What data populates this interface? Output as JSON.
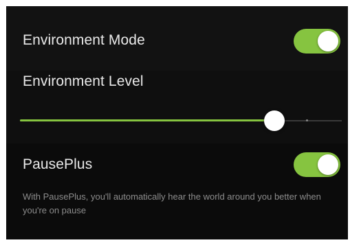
{
  "colors": {
    "accent": "#86c440",
    "panel_background": "#0b0b0b",
    "label_text": "#e9e9e9",
    "description_text": "#8c8c8c"
  },
  "environment_mode": {
    "label": "Environment Mode",
    "enabled": true
  },
  "environment_level": {
    "label": "Environment Level",
    "value_fraction": 0.79
  },
  "pauseplus": {
    "label": "PausePlus",
    "enabled": true,
    "description": "With PausePlus, you'll automatically hear the world around you better when you're on pause"
  }
}
